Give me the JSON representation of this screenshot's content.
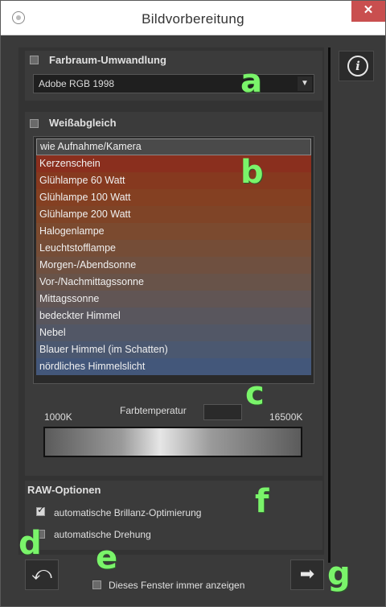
{
  "window": {
    "title": "Bildvorbereitung",
    "close_label": "✕",
    "info_label": "i"
  },
  "colorspace": {
    "label": "Farbraum-Umwandlung",
    "checked": false,
    "selected": "Adobe RGB 1998",
    "arrow": "▼"
  },
  "whitebalance": {
    "label": "Weißabgleich",
    "checked": false,
    "items": [
      {
        "label": "wie Aufnahme/Kamera",
        "color": "#4a4a4a",
        "selected": true
      },
      {
        "label": "Kerzenschein",
        "color": "#8a2f1e"
      },
      {
        "label": "Glühlampe 60 Watt",
        "color": "#86391f"
      },
      {
        "label": "Glühlampe 100 Watt",
        "color": "#844022"
      },
      {
        "label": "Glühlampe 200 Watt",
        "color": "#7f4427"
      },
      {
        "label": "Halogenlampe",
        "color": "#7b4a2f"
      },
      {
        "label": "Leuchtstofflampe",
        "color": "#754d37"
      },
      {
        "label": "Morgen-/Abendsonne",
        "color": "#6f5040"
      },
      {
        "label": "Vor-/Nachmittagssonne",
        "color": "#685349"
      },
      {
        "label": "Mittagssonne",
        "color": "#615554"
      },
      {
        "label": "bedeckter Himmel",
        "color": "#59565d"
      },
      {
        "label": "Nebel",
        "color": "#525766"
      },
      {
        "label": "Blauer Himmel (im Schatten)",
        "color": "#4b5870"
      },
      {
        "label": "nördliches Himmelslicht",
        "color": "#43577a"
      }
    ]
  },
  "temperature": {
    "min_label": "1000K",
    "max_label": "16500K",
    "label": "Farbtemperatur",
    "value": ""
  },
  "raw": {
    "label": "RAW-Optionen",
    "options": [
      {
        "label": "automatische Brillanz-Optimierung",
        "checked": true
      },
      {
        "label": "automatische Drehung",
        "checked": false
      }
    ]
  },
  "footer": {
    "always_show_label": "Dieses Fenster immer anzeigen",
    "always_show_checked": false,
    "undo_icon": "⤺",
    "next_icon": "➡"
  },
  "annotations": {
    "a": "a",
    "b": "b",
    "c": "c",
    "d": "d",
    "e": "e",
    "f": "f",
    "g": "g"
  },
  "colors": {
    "window_bg": "#3a3a3a",
    "panel_bg": "#333333",
    "close_red": "#c94f4f",
    "annotation_green": "#7af46a"
  }
}
